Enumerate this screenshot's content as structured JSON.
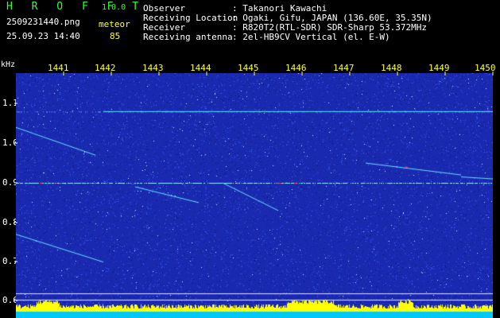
{
  "header": {
    "brand": "H R O F F T",
    "version": "1.0.0",
    "filename": "2509231440.png",
    "datetime": "25.09.23 14:40",
    "mode_label": "meteor",
    "meteor_count": "85"
  },
  "info": {
    "rows": [
      {
        "label": "Observer",
        "value": ": Takanori Kawachi"
      },
      {
        "label": "Receiving Location",
        "value": ": Ogaki, Gifu, JAPAN (136.60E, 35.35N)"
      },
      {
        "label": "Receiver",
        "value": ": R820T2(RTL-SDR) SDR-Sharp 53.372MHz"
      },
      {
        "label": "Receiving antenna",
        "value": ": 2el-HB9CV Vertical (el. E-W)"
      }
    ]
  },
  "axis": {
    "unit": "kHz",
    "time_ticks": [
      "1441",
      "1442",
      "1443",
      "1444",
      "1445",
      "1446",
      "1447",
      "1448",
      "1449",
      "1450"
    ],
    "freq_ticks": [
      "1.1",
      "1.0",
      "0.9",
      "0.8",
      "0.7",
      "0.6"
    ]
  },
  "colors": {
    "background": "#000000",
    "spectrogram_base": "#1a2ab0",
    "noise": "#3a6aff",
    "carrier_line": "#8ff0ff",
    "meteor_trace": "#66e0ff",
    "hot_spot": "#ff3a3a",
    "level_bar": "#ffff00",
    "baseline_band": "#00c8ff"
  }
}
